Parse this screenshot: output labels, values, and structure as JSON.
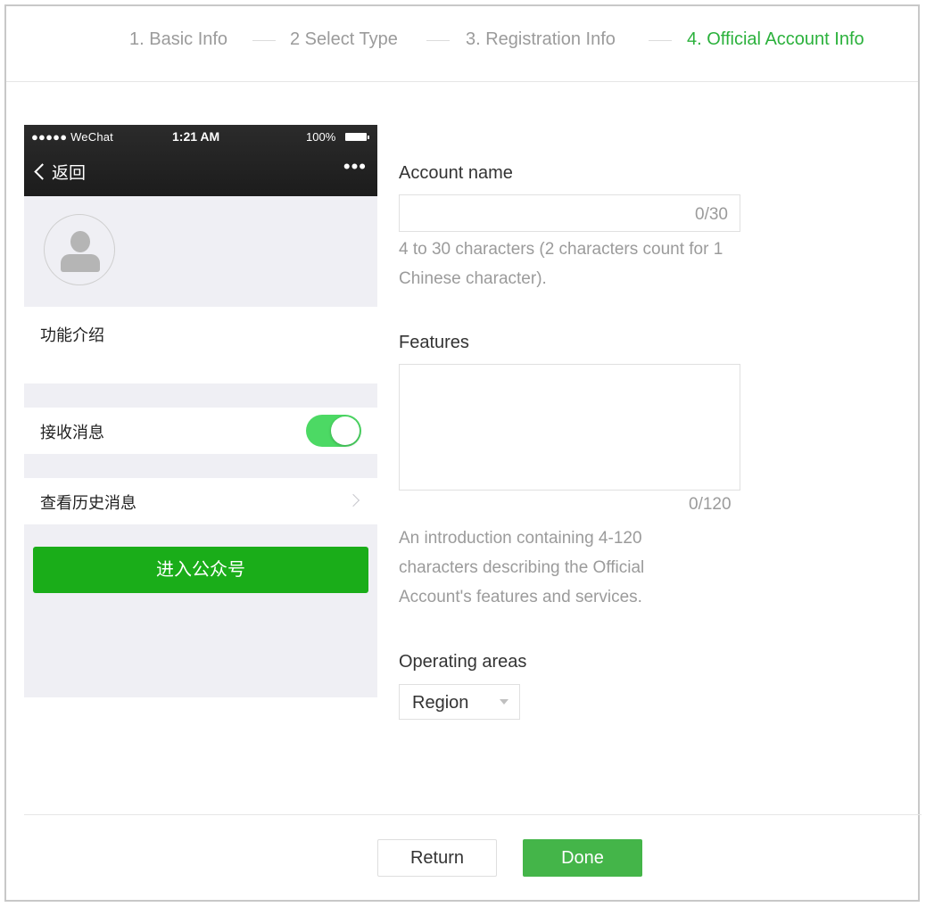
{
  "steps": [
    {
      "label": "1. Basic Info"
    },
    {
      "label": "2 Select Type"
    },
    {
      "label": "3. Registration Info"
    },
    {
      "label": "4. Official Account Info"
    }
  ],
  "preview": {
    "carrier": "●●●●● WeChat",
    "time": "1:21 AM",
    "battery": "100%",
    "back_label": "返回",
    "more_icon": "•••",
    "intro_label": "功能介绍",
    "receive_label": "接收消息",
    "receive_enabled": true,
    "history_label": "查看历史消息",
    "enter_button": "进入公众号"
  },
  "form": {
    "account_name": {
      "label": "Account name",
      "value": "",
      "counter": "0/30",
      "hint": "4 to 30 characters (2 characters count for 1 Chinese character)."
    },
    "features": {
      "label": "Features",
      "value": "",
      "counter": "0/120",
      "hint": "An introduction containing 4-120 characters describing the Official Account's features and services."
    },
    "operating_areas": {
      "label": "Operating areas",
      "select_value": "Region"
    }
  },
  "footer": {
    "return_label": "Return",
    "done_label": "Done"
  },
  "colors": {
    "accent": "#2bb13c",
    "done_button": "#44b549",
    "enter_button": "#1aad19",
    "toggle_on": "#4cd964"
  }
}
